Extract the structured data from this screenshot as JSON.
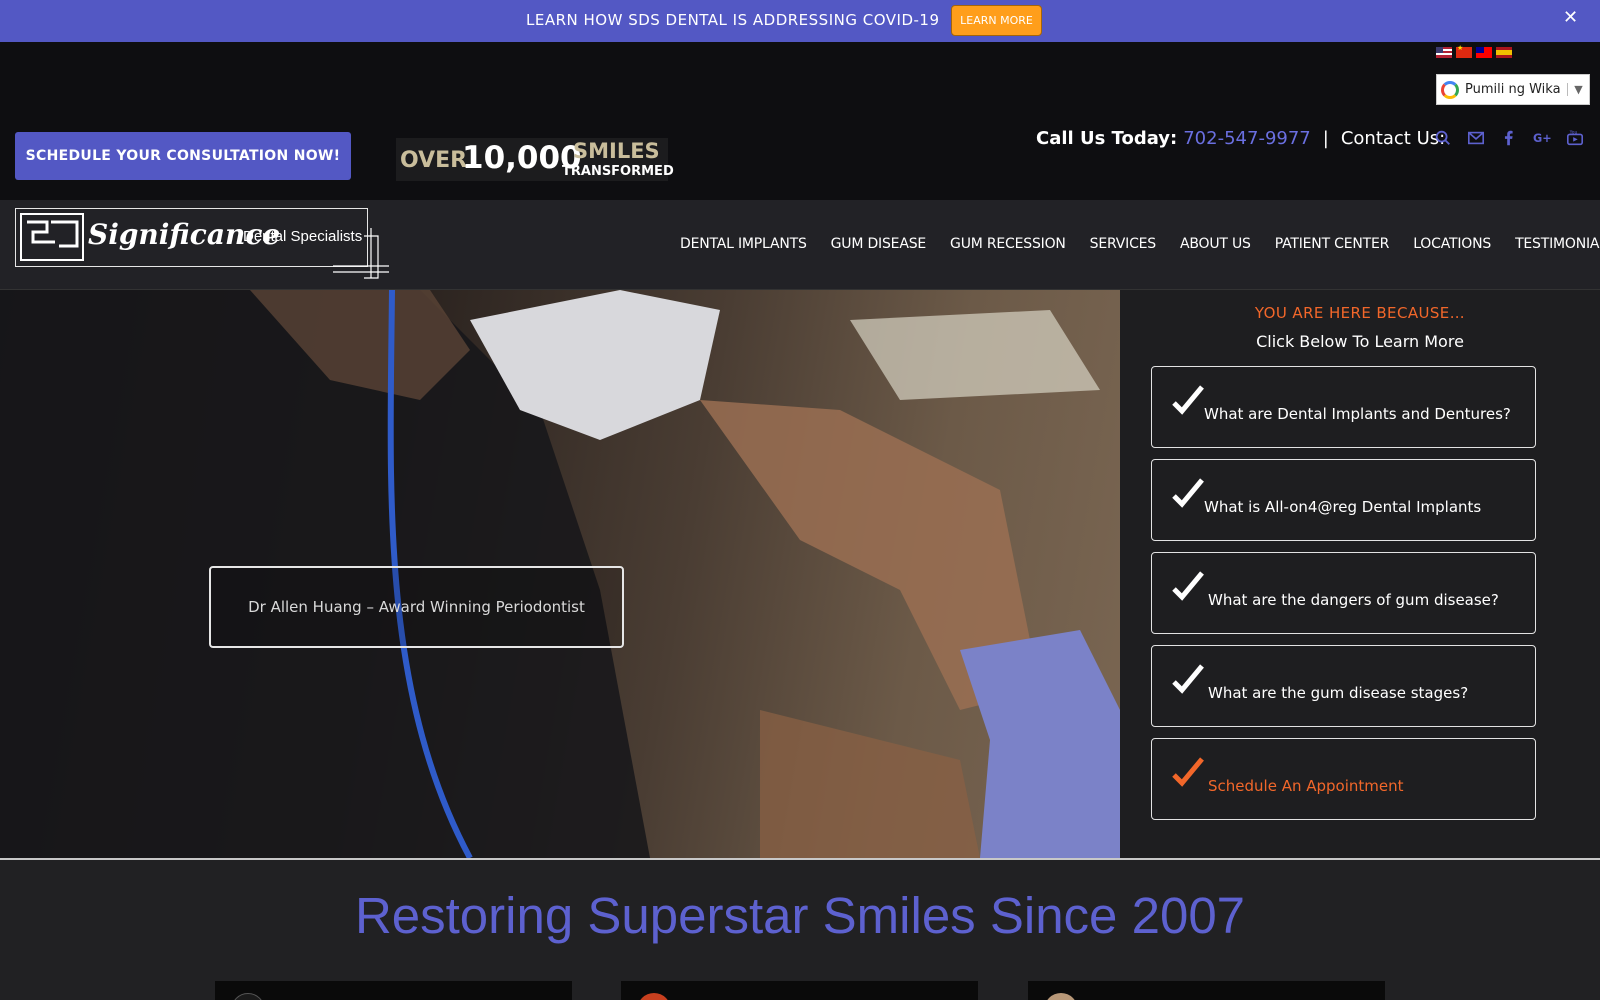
{
  "covid_bar": {
    "text": "LEARN HOW SDS DENTAL IS ADDRESSING COVID-19",
    "button": "LEARN MORE",
    "close": "✕"
  },
  "header": {
    "flags": [
      "us-flag-icon",
      "china-flag-icon",
      "taiwan-flag-icon",
      "spain-flag-icon"
    ],
    "language_select": {
      "value": "Pumili ng Wika",
      "arrow": "▼"
    },
    "consult_button": "SCHEDULE YOUR CONSULTATION NOW!",
    "smiles": {
      "over": "OVER",
      "number": "10,000",
      "word": "SMILES",
      "sub": "TRANSFORMED"
    },
    "call_label": "Call Us Today:",
    "phone": "702-547-9977",
    "separator": "|",
    "contact_label": "Contact Us:",
    "contact_icons": [
      "search-icon",
      "mail-icon",
      "facebook-icon",
      "google-plus-icon",
      "youtube-icon"
    ]
  },
  "logo": {
    "brand": "Significance",
    "tagline": "Dental Specialists"
  },
  "nav": [
    "DENTAL IMPLANTS",
    "GUM DISEASE",
    "GUM RECESSION",
    "SERVICES",
    "ABOUT US",
    "PATIENT CENTER",
    "LOCATIONS",
    "TESTIMONIALS"
  ],
  "hero": {
    "caption": "Dr Allen Huang – Award Winning Periodontist"
  },
  "aside": {
    "kicker": "YOU ARE HERE BECAUSE…",
    "sub": "Click Below To Learn More",
    "items": [
      "What are Dental Implants and Dentures?",
      "What is All-on4@reg Dental Implants",
      "What are the dangers of gum disease?",
      "What are the gum disease stages?",
      "Schedule An Appointment"
    ]
  },
  "headline": "Restoring Superstar Smiles Since 2007",
  "colors": {
    "brand_purple": "#5358c4",
    "accent_orange": "#f2672a",
    "cta_orange": "#ff9e1b"
  }
}
